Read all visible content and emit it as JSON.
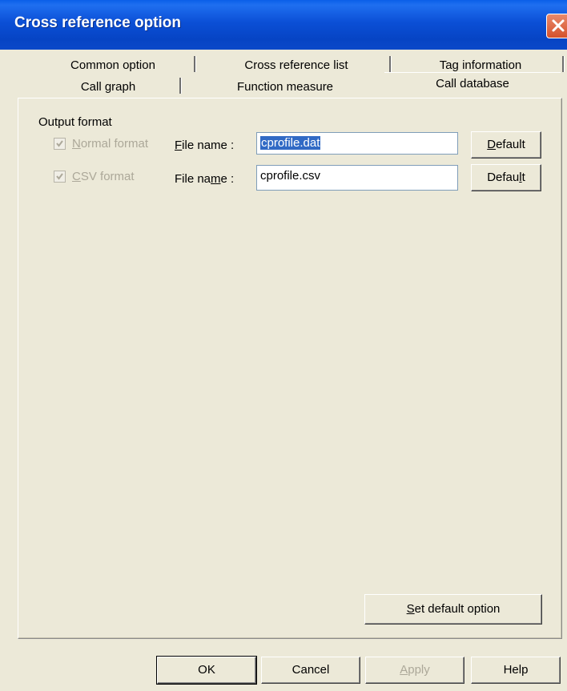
{
  "window": {
    "title": "Cross reference option"
  },
  "tabs": {
    "row1": [
      "Common option",
      "Cross reference list",
      "Tag information"
    ],
    "row2": [
      "Call graph",
      "Function measure",
      "Call database"
    ],
    "active": "Call database"
  },
  "output_format": {
    "group_label": "Output format",
    "rows": [
      {
        "checkbox_label_pre": "",
        "checkbox_label_key": "N",
        "checkbox_label_post": "ormal format",
        "checked": true,
        "enabled": false,
        "file_label_pre": "",
        "file_label_key": "F",
        "file_label_post": "ile name :",
        "file_value": "cprofile.dat",
        "default_pre": "",
        "default_key": "D",
        "default_post": "efault"
      },
      {
        "checkbox_label_pre": "",
        "checkbox_label_key": "C",
        "checkbox_label_post": "SV format",
        "checked": true,
        "enabled": false,
        "file_label_pre": "File na",
        "file_label_key": "m",
        "file_label_post": "e :",
        "file_value": "cprofile.csv",
        "default_pre": "Defau",
        "default_key": "l",
        "default_post": "t"
      }
    ]
  },
  "set_default": {
    "pre": "",
    "key": "S",
    "post": "et default option"
  },
  "footer": {
    "ok": "OK",
    "cancel": "Cancel",
    "apply_pre": "",
    "apply_key": "A",
    "apply_post": "pply",
    "help": "Help"
  }
}
